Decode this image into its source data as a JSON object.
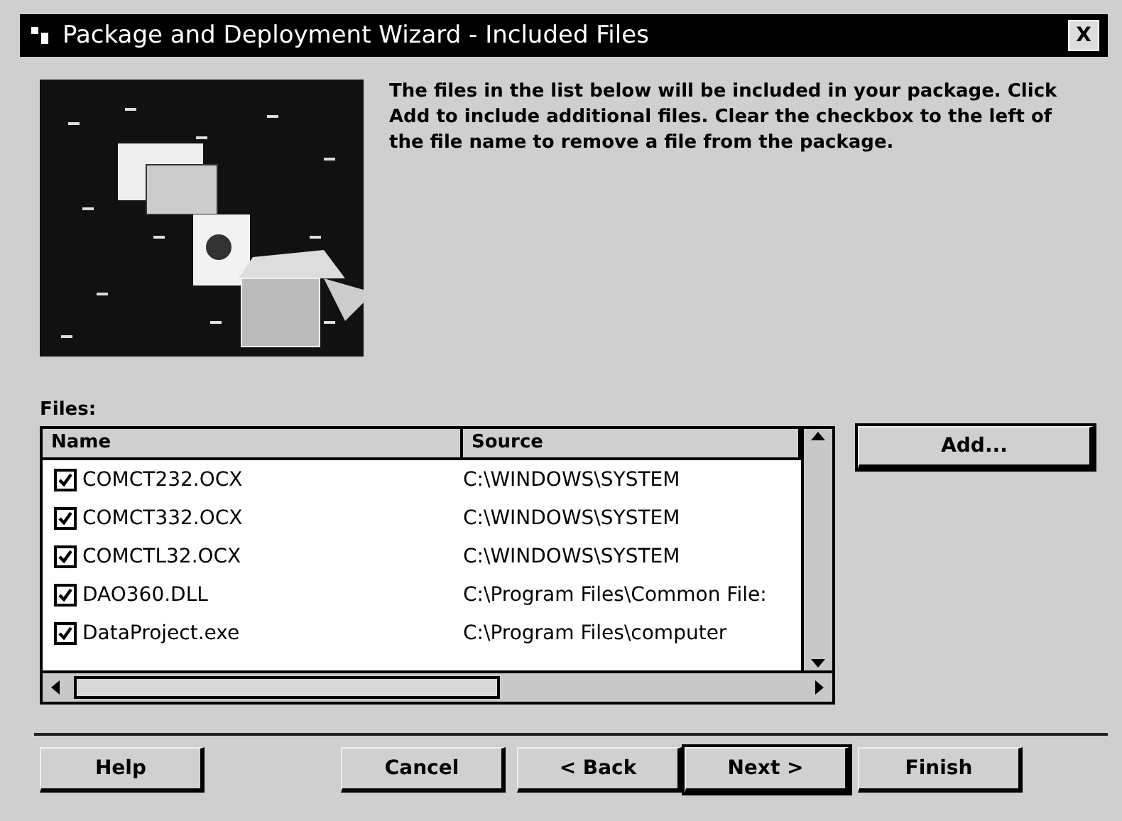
{
  "window": {
    "title": "Package and Deployment Wizard - Included Files",
    "close": "X"
  },
  "intro": "The files in the list below will be included in your package. Click Add to include additional files. Clear the checkbox to the left of the file name to remove a file from the package.",
  "files_label": "Files:",
  "table": {
    "columns": [
      "Name",
      "Source"
    ],
    "rows": [
      {
        "name": "COMCT232.OCX",
        "source": "C:\\WINDOWS\\SYSTEM",
        "checked": true
      },
      {
        "name": "COMCT332.OCX",
        "source": "C:\\WINDOWS\\SYSTEM",
        "checked": true
      },
      {
        "name": "COMCTL32.OCX",
        "source": "C:\\WINDOWS\\SYSTEM",
        "checked": true
      },
      {
        "name": "DAO360.DLL",
        "source": "C:\\Program Files\\Common File:",
        "checked": true
      },
      {
        "name": "DataProject.exe",
        "source": "C:\\Program Files\\computer",
        "checked": true
      }
    ]
  },
  "add_button": "Add...",
  "buttons": [
    {
      "label": "Help",
      "default": false
    },
    {
      "label": "Cancel",
      "default": false
    },
    {
      "label": "< Back",
      "default": false
    },
    {
      "label": "Next >",
      "default": true
    },
    {
      "label": "Finish",
      "default": false
    }
  ]
}
